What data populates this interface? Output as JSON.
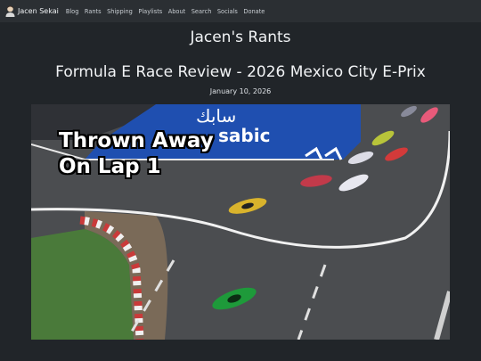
{
  "nav": {
    "brand": "Jacen Sekai",
    "links": [
      "Blog",
      "Rants",
      "Shipping",
      "Playlists",
      "About",
      "Search",
      "Socials",
      "Donate"
    ]
  },
  "site_title": "Jacen's Rants",
  "post": {
    "title": "Formula E Race Review - 2026 Mexico City E-Prix",
    "date": "January 10, 2026",
    "hero_caption_line1": "Thrown Away",
    "hero_caption_line2": "On Lap 1",
    "hero_sponsor_arabic": "سابك",
    "hero_sponsor_latin": "sabic",
    "body_preview": ""
  },
  "colors": {
    "page_bg": "#212529",
    "navbar_bg": "#2b2f33",
    "track_surface": "#4b4d50",
    "sponsor_blue": "#1f4fb0"
  }
}
